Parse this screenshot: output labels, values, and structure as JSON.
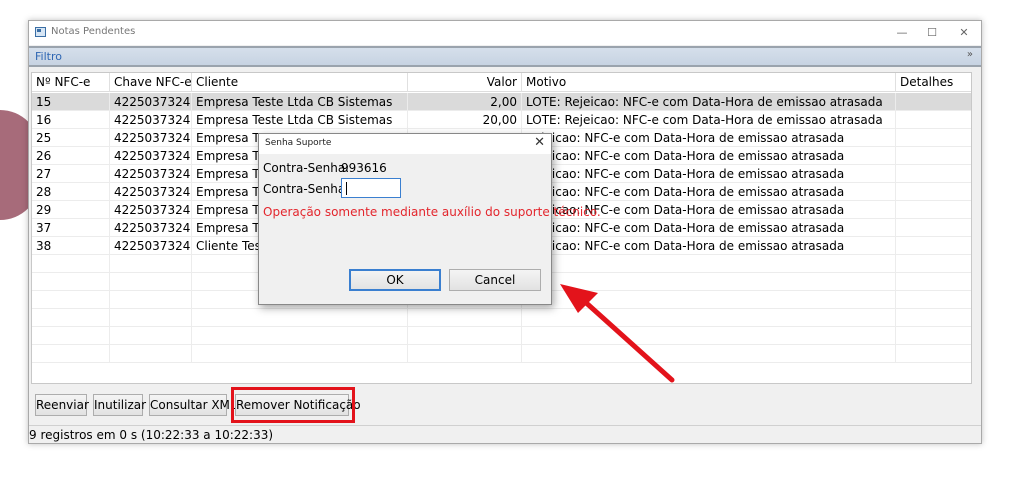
{
  "window": {
    "title": "Notas Pendentes",
    "minimize_glyph": "—",
    "maximize_glyph": "☐",
    "close_glyph": "✕"
  },
  "filter": {
    "label": "Filtro",
    "chevron": "»"
  },
  "table": {
    "columns": [
      "Nº NFC-e",
      "Chave NFC-e",
      "Cliente",
      "Valor",
      "Motivo",
      "Detalhes"
    ],
    "rows": [
      {
        "num": "15",
        "key": "4225037324...",
        "client": "Empresa Teste Ltda CB Sistemas",
        "value": "2,00",
        "reason": "LOTE: Rejeicao: NFC-e com Data-Hora de emissao atrasada",
        "details": ""
      },
      {
        "num": "16",
        "key": "4225037324...",
        "client": "Empresa Teste Ltda CB Sistemas",
        "value": "20,00",
        "reason": "LOTE: Rejeicao: NFC-e com Data-Hora de emissao atrasada",
        "details": ""
      },
      {
        "num": "25",
        "key": "4225037324...",
        "client": "Empresa Tes",
        "value": "",
        "reason": "Rejeicao: NFC-e com Data-Hora de emissao atrasada",
        "details": ""
      },
      {
        "num": "26",
        "key": "4225037324...",
        "client": "Empresa Tes",
        "value": "",
        "reason": "Rejeicao: NFC-e com Data-Hora de emissao atrasada",
        "details": ""
      },
      {
        "num": "27",
        "key": "4225037324...",
        "client": "Empresa Tes",
        "value": "",
        "reason": "Rejeicao: NFC-e com Data-Hora de emissao atrasada",
        "details": ""
      },
      {
        "num": "28",
        "key": "4225037324...",
        "client": "Empresa Tes",
        "value": "",
        "reason": "Rejeicao: NFC-e com Data-Hora de emissao atrasada",
        "details": ""
      },
      {
        "num": "29",
        "key": "4225037324...",
        "client": "Empresa Tes",
        "value": "",
        "reason": "Rejeicao: NFC-e com Data-Hora de emissao atrasada",
        "details": ""
      },
      {
        "num": "37",
        "key": "4225037324...",
        "client": "Empresa Tes",
        "value": "",
        "reason": "Rejeicao: NFC-e com Data-Hora de emissao atrasada",
        "details": ""
      },
      {
        "num": "38",
        "key": "4225037324...",
        "client": "Cliente Teste",
        "value": "",
        "reason": "Rejeicao: NFC-e com Data-Hora de emissao atrasada",
        "details": ""
      }
    ],
    "selected_row": 0
  },
  "toolbar": {
    "reenviar": "Reenviar",
    "inutilizar": "Inutilizar",
    "consultar_xml": "Consultar XML",
    "remover_notificacao": "Remover Notificação"
  },
  "status": {
    "text": "9 registros em 0 s (10:22:33 a 10:22:33)"
  },
  "dialog": {
    "title": "Senha Suporte",
    "close_glyph": "✕",
    "counter_label": "Contra-Senha:",
    "counter_value": "993616",
    "input_label": "Contra-Senha:",
    "input_value": "",
    "warning": "Operação somente mediante auxílio do suporte técnico.",
    "ok_label": "OK",
    "cancel_label": "Cancel"
  },
  "colors": {
    "highlight_red": "#e3131b",
    "warning_red": "#e3262d",
    "filter_text": "#2e66b3",
    "selected_row": "#dadada"
  }
}
